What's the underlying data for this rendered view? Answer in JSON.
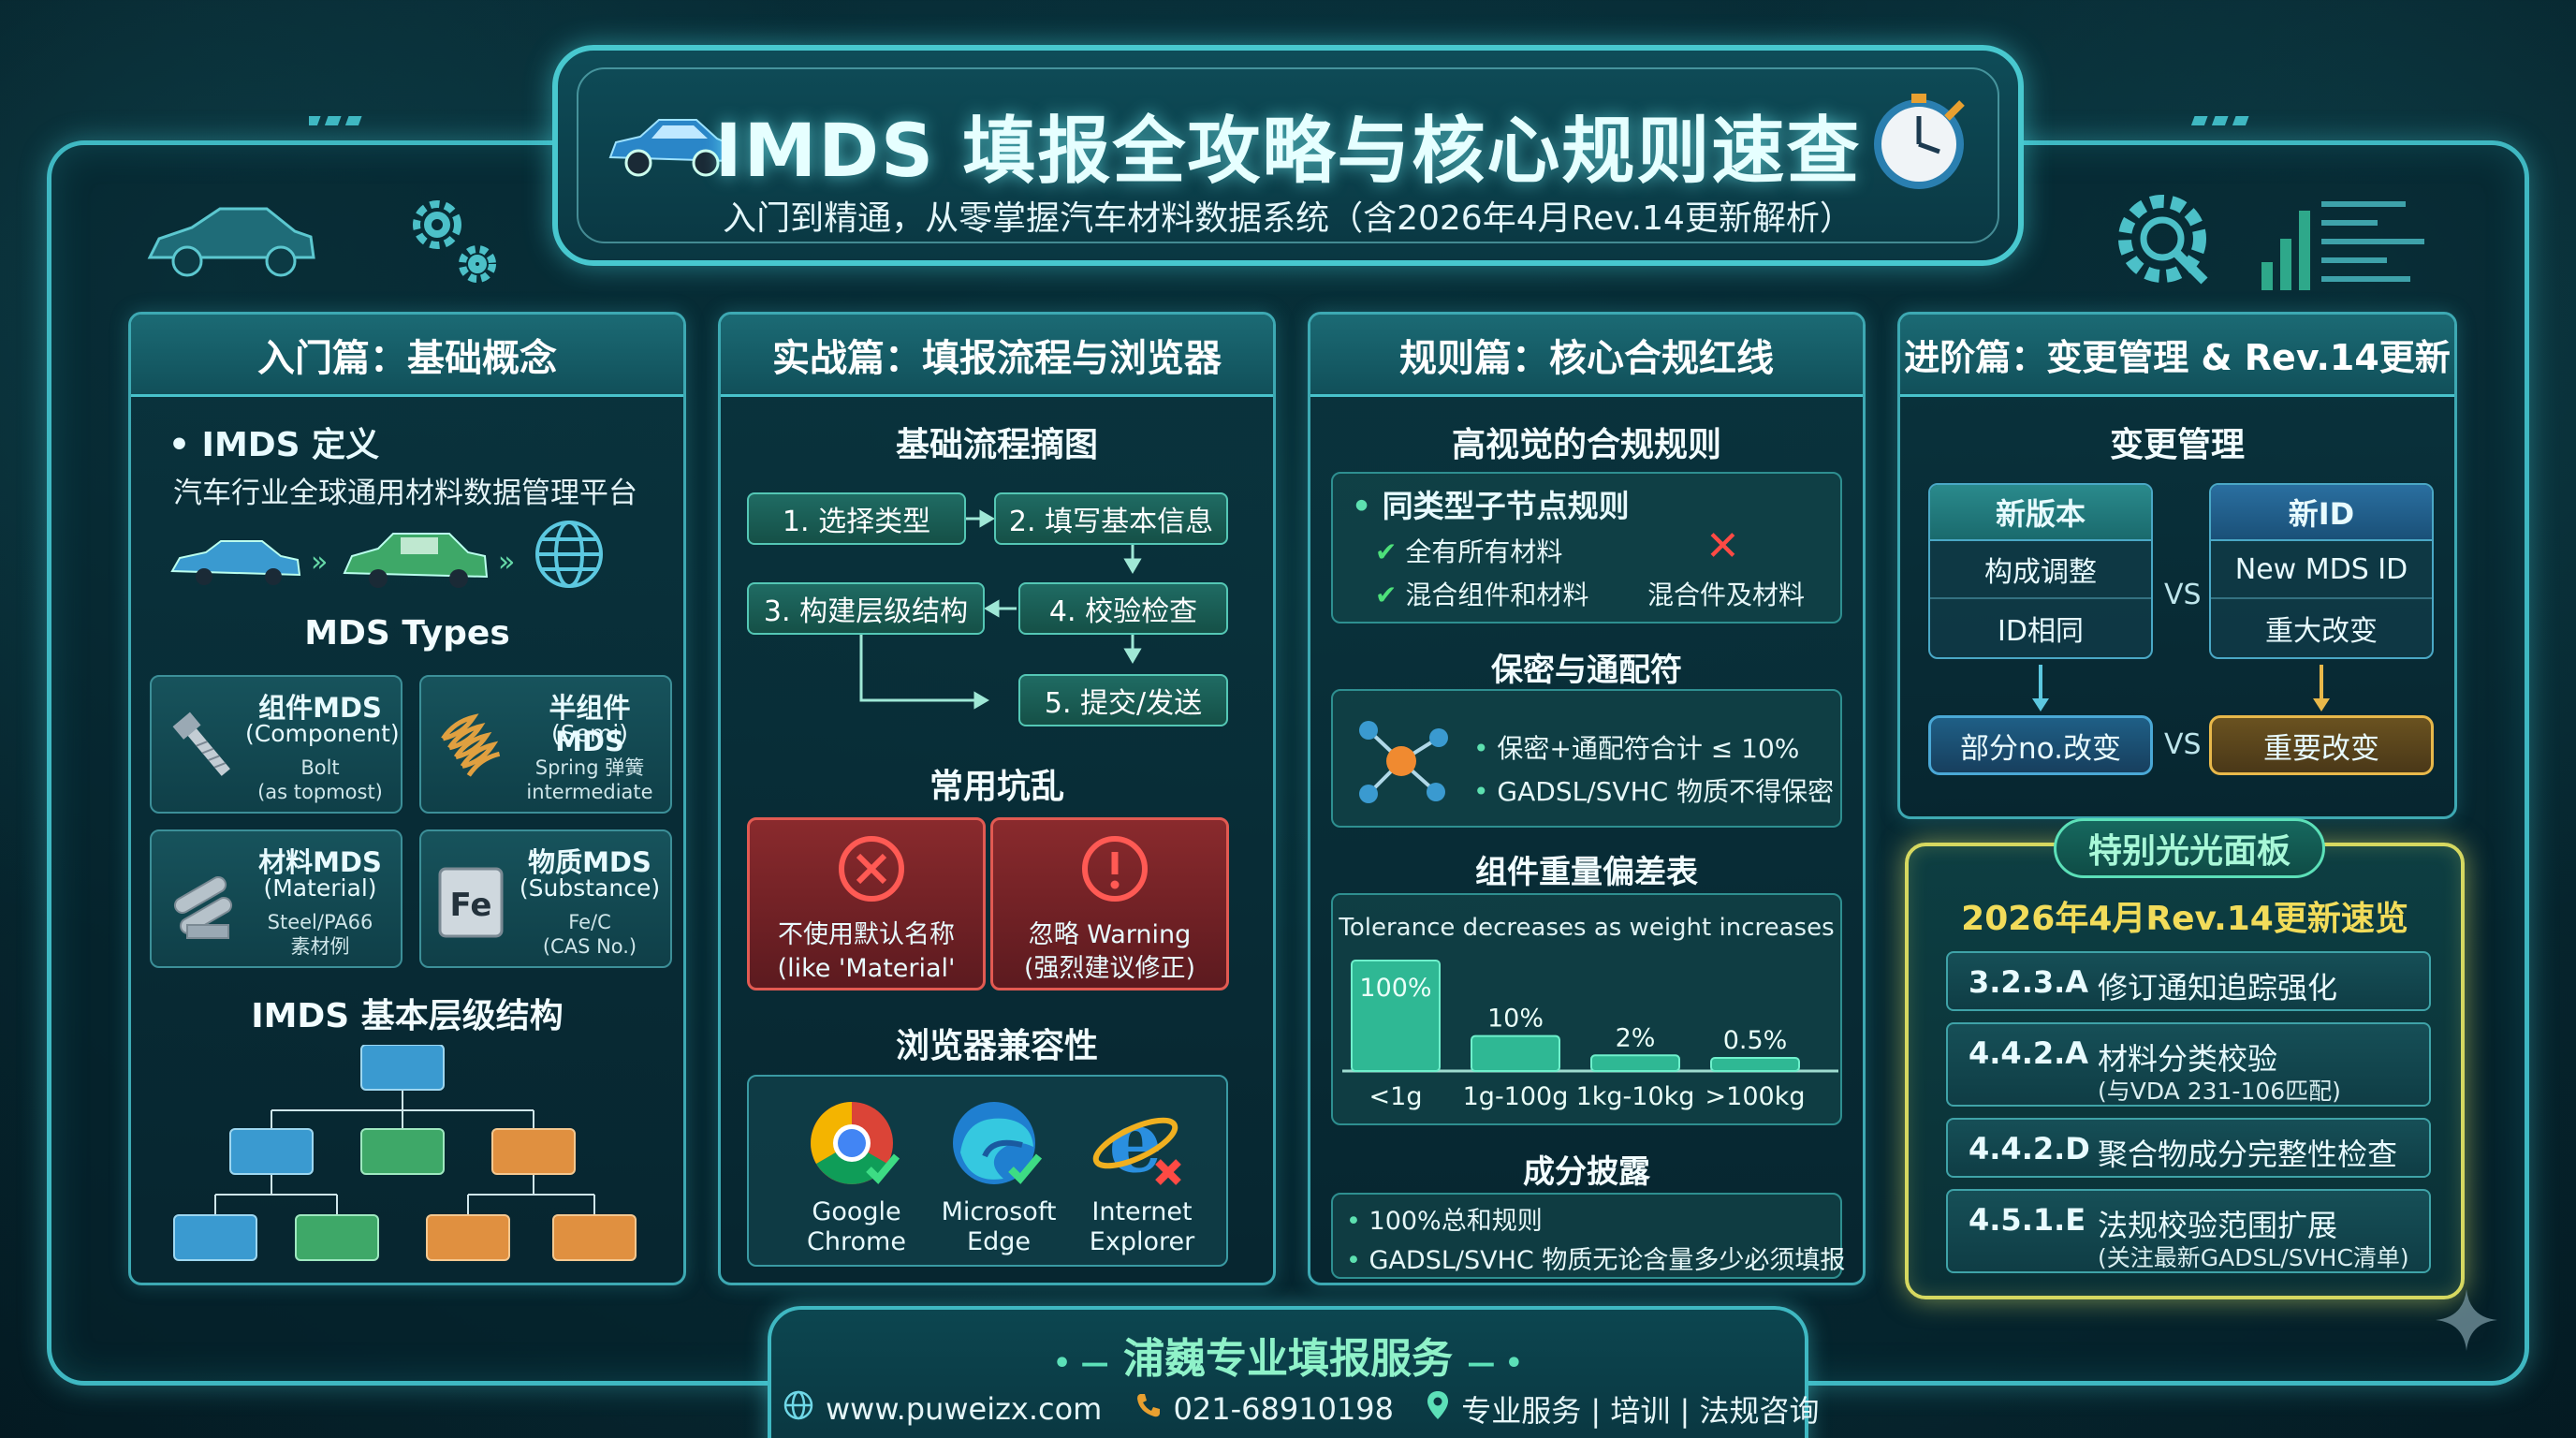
{
  "header": {
    "title": "IMDS 填报全攻略与核心规则速查",
    "subtitle": "入门到精通，从零掌握汽车材料数据系统（含2026年4月Rev.14更新解析）"
  },
  "panel1": {
    "heading": "入门篇：基础概念",
    "definition_title": "IMDS 定义",
    "definition_text": "汽车行业全球通用材料数据管理平台",
    "types_title": "MDS Types",
    "types": [
      {
        "name": "组件MDS",
        "en": "(Component)",
        "example": "Bolt",
        "note": "(as topmost)",
        "icon": "bolt-icon"
      },
      {
        "name": "半组件MDS",
        "en": "(Semi)",
        "example": "Spring 弹簧",
        "note": "intermediate",
        "icon": "spring-icon"
      },
      {
        "name": "材料MDS",
        "en": "(Material)",
        "example": "Steel/PA66",
        "note": "素材例",
        "icon": "material-bars-icon"
      },
      {
        "name": "物质MDS",
        "en": "(Substance)",
        "example": "Fe/C",
        "note": "(CAS No.)",
        "icon": "fe-element-icon"
      }
    ],
    "fe_symbol": "Fe",
    "hierarchy_title": "IMDS 基本层级结构"
  },
  "panel2": {
    "heading": "实战篇：填报流程与浏览器",
    "flow_title": "基础流程摘图",
    "steps": [
      "1. 选择类型",
      "2. 填写基本信息",
      "3. 构建层级结构",
      "4. 校验检查",
      "5. 提交/发送"
    ],
    "pitfalls_title": "常用坑乱",
    "pitfalls": [
      {
        "line1": "不使用默认名称",
        "line2": "(like 'Material'",
        "icon": "error-x-icon"
      },
      {
        "line1": "忽略 Warning",
        "line2": "(强烈建议修正)",
        "icon": "warning-icon"
      }
    ],
    "browsers_title": "浏览器兼容性",
    "browsers": [
      {
        "line1": "Google",
        "line2": "Chrome",
        "status": "ok"
      },
      {
        "line1": "Microsoft",
        "line2": "Edge",
        "status": "ok"
      },
      {
        "line1": "Internet",
        "line2": "Explorer",
        "status": "no"
      }
    ]
  },
  "panel3": {
    "heading": "规则篇：核心合规红线",
    "rules_title": "高视觉的合规规则",
    "sibling_rule_title": "同类型子节点规则",
    "allowed": [
      "全有所有材料",
      "混合组件和材料"
    ],
    "disallowed": "混合件及材料",
    "confidential_title": "保密与通配符",
    "confidential_items": [
      "保密+通配符合计 ≤ 10%",
      "GADSL/SVHC 物质不得保密"
    ],
    "tolerance_title": "组件重量偏差表",
    "tolerance_note": "Tolerance decreases as weight increases",
    "composition_title": "成分披露",
    "composition_items": [
      "100%总和规则",
      "GADSL/SVHC 物质无论含量多少必须填报"
    ]
  },
  "chart_data": {
    "type": "bar",
    "title": "组件重量偏差表",
    "subtitle": "Tolerance decreases as weight increases",
    "categories": [
      "<1g",
      "1g-100g",
      "1kg-10kg",
      ">100kg"
    ],
    "values": [
      100,
      10,
      2,
      0.5
    ],
    "value_labels": [
      "100%",
      "10%",
      "2%",
      "0.5%"
    ],
    "xlabel": "",
    "ylabel": ""
  },
  "panel4": {
    "heading": "进阶篇：变更管理 & Rev.14更新",
    "change_title": "变更管理",
    "left_col": {
      "head": "新版本",
      "rows": [
        "构成调整",
        "ID相同"
      ],
      "result": "部分no.改变"
    },
    "right_col": {
      "head": "新ID",
      "rows": [
        "New MDS ID",
        "重大改变"
      ],
      "result": "重要改变"
    },
    "vs": "VS",
    "special_badge": "特别光光面板",
    "rev_title": "2026年4月Rev.14更新速览",
    "rev_items": [
      {
        "code": "3.2.3.A",
        "desc": "修订通知追踪强化",
        "sub": ""
      },
      {
        "code": "4.4.2.A",
        "desc": "材料分类校验",
        "sub": "(与VDA 231-106匹配)"
      },
      {
        "code": "4.4.2.D",
        "desc": "聚合物成分完整性检查",
        "sub": ""
      },
      {
        "code": "4.5.1.E",
        "desc": "法规校验范围扩展",
        "sub": "(关注最新GADSL/SVHC清单)"
      }
    ]
  },
  "footer": {
    "title": "浦巍专业填报服务",
    "website": "www.puweizx.com",
    "phone": "021-68910198",
    "services": "专业服务 | 培训 | 法规咨询"
  },
  "colors": {
    "accent": "#3fb8c2",
    "green": "#2f9b7f",
    "red": "#e25a52",
    "gold": "#e8b84a",
    "orange": "#e09040",
    "blue": "#3a9ad0"
  }
}
